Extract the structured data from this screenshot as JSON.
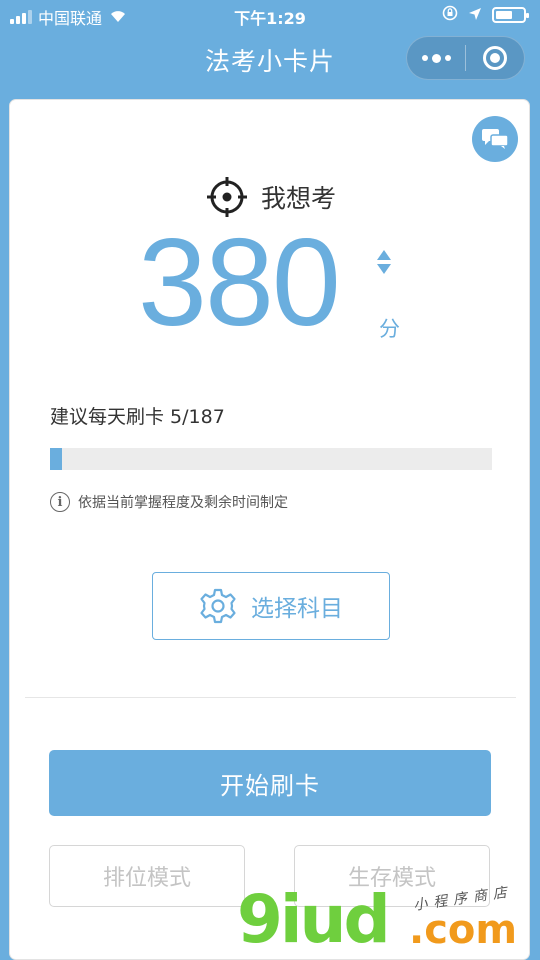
{
  "status_bar": {
    "carrier": "中国联通",
    "time": "下午1:29",
    "battery_level": 0.6,
    "icons": [
      "signal-icon",
      "wifi-icon",
      "rotation-lock-icon",
      "location-icon",
      "battery-icon"
    ]
  },
  "nav": {
    "title": "法考小卡片",
    "icons": [
      "more-dots-icon",
      "close-target-icon"
    ]
  },
  "main": {
    "chat_icon": "chat-bubbles-icon",
    "target_label": "我想考",
    "score": "380",
    "score_unit": "分",
    "suggest_text": "建议每天刷卡 5/187",
    "progress": 0.0267,
    "note": "依据当前掌握程度及剩余时间制定",
    "select_subject_label": "选择科目",
    "start_label": "开始刷卡",
    "rank_mode_label": "排位模式",
    "survival_mode_label": "生存模式"
  },
  "watermark": {
    "brand": "9iud",
    "suffix": ".com",
    "tagline": "小程序商店"
  },
  "colors": {
    "accent": "#6aaede",
    "disabled_text": "#c4c4c4",
    "watermark_green": "#6fcf3e",
    "watermark_orange": "#f19a1c"
  }
}
